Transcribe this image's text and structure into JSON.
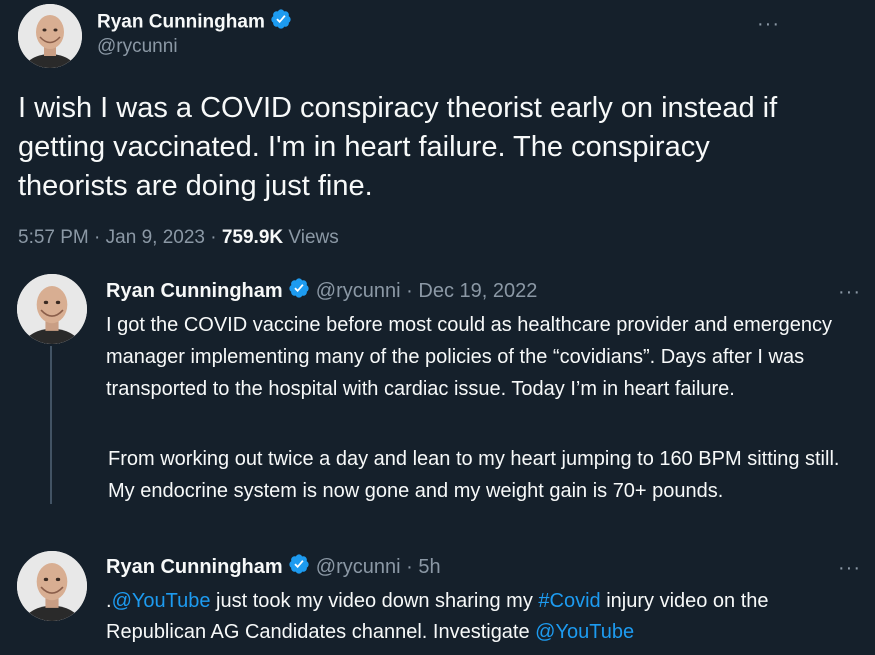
{
  "main_tweet": {
    "author_name": "Ryan Cunningham",
    "handle": "@rycunni",
    "text": "I wish I was a COVID conspiracy theorist early on instead if getting vaccinated.  I'm in heart failure.  The conspiracy theorists are doing just fine.",
    "time": "5:57 PM",
    "date": "Jan 9, 2023",
    "sep": "·",
    "views_count": "759.9K",
    "views_label": "Views",
    "more_icon": "···"
  },
  "reply_1": {
    "author_name": "Ryan Cunningham",
    "handle": "@rycunni",
    "sep": "·",
    "date": "Dec 19, 2022",
    "paragraph_1": "I got the COVID vaccine before most could as healthcare provider and emergency manager implementing many of the policies of the “covidians”. Days after I was transported to the hospital with cardiac issue.  Today I’m in heart failure.",
    "paragraph_2": "From working out twice a day and lean to my heart jumping to 160 BPM sitting still.  My endocrine system is now gone and my weight gain is 70+ pounds.",
    "more_icon": "···"
  },
  "reply_2": {
    "author_name": "Ryan Cunningham",
    "handle": "@rycunni",
    "sep": "·",
    "time_ago": "5h",
    "text_dot": ".",
    "mention_youtube_1": "@YouTube",
    "text_1": " just took my video down sharing my ",
    "hashtag_covid": "#Covid",
    "text_2": " injury video on the Republican AG Candidates channel.   Investigate ",
    "mention_youtube_2": "@YouTube",
    "more_icon": "···"
  },
  "colors": {
    "background": "#15202b",
    "text": "#f7f9f9",
    "secondary": "#8b98a5",
    "link": "#1d9bf0",
    "verified": "#1d9bf0"
  }
}
